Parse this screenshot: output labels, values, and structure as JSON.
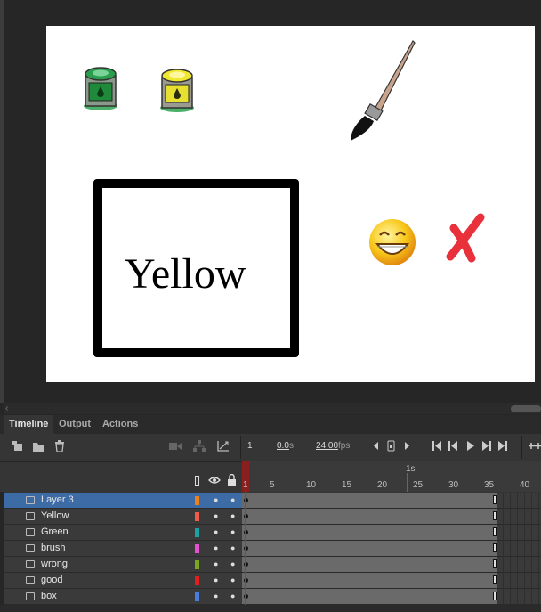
{
  "stage": {
    "text": "Yellow",
    "objects": [
      "green-paint-can",
      "yellow-paint-can",
      "paint-brush",
      "smiley-face",
      "red-x"
    ]
  },
  "tabs": [
    {
      "label": "Timeline",
      "active": true
    },
    {
      "label": "Output",
      "active": false
    },
    {
      "label": "Actions",
      "active": false
    }
  ],
  "toolbar": {
    "frame": "1",
    "time": "0.0",
    "time_unit": "s",
    "fps": "24.00",
    "fps_unit": "fps"
  },
  "ruler": {
    "second_marker": "1s",
    "numbers": [
      "1",
      "5",
      "10",
      "15",
      "20",
      "25",
      "30",
      "35",
      "40"
    ]
  },
  "layers": [
    {
      "name": "Layer 3",
      "color": "#e8821e",
      "selected": true
    },
    {
      "name": "Yellow",
      "color": "#f05a4a",
      "selected": false
    },
    {
      "name": "Green",
      "color": "#1aa3a3",
      "selected": false
    },
    {
      "name": "brush",
      "color": "#e64fd0",
      "selected": false
    },
    {
      "name": "wrong",
      "color": "#7aa61e",
      "selected": false
    },
    {
      "name": "good",
      "color": "#e02020",
      "selected": false
    },
    {
      "name": "box",
      "color": "#4a7ce0",
      "selected": false
    }
  ],
  "colors": {
    "accent": "#3d6ba5",
    "playhead": "#c03030"
  }
}
